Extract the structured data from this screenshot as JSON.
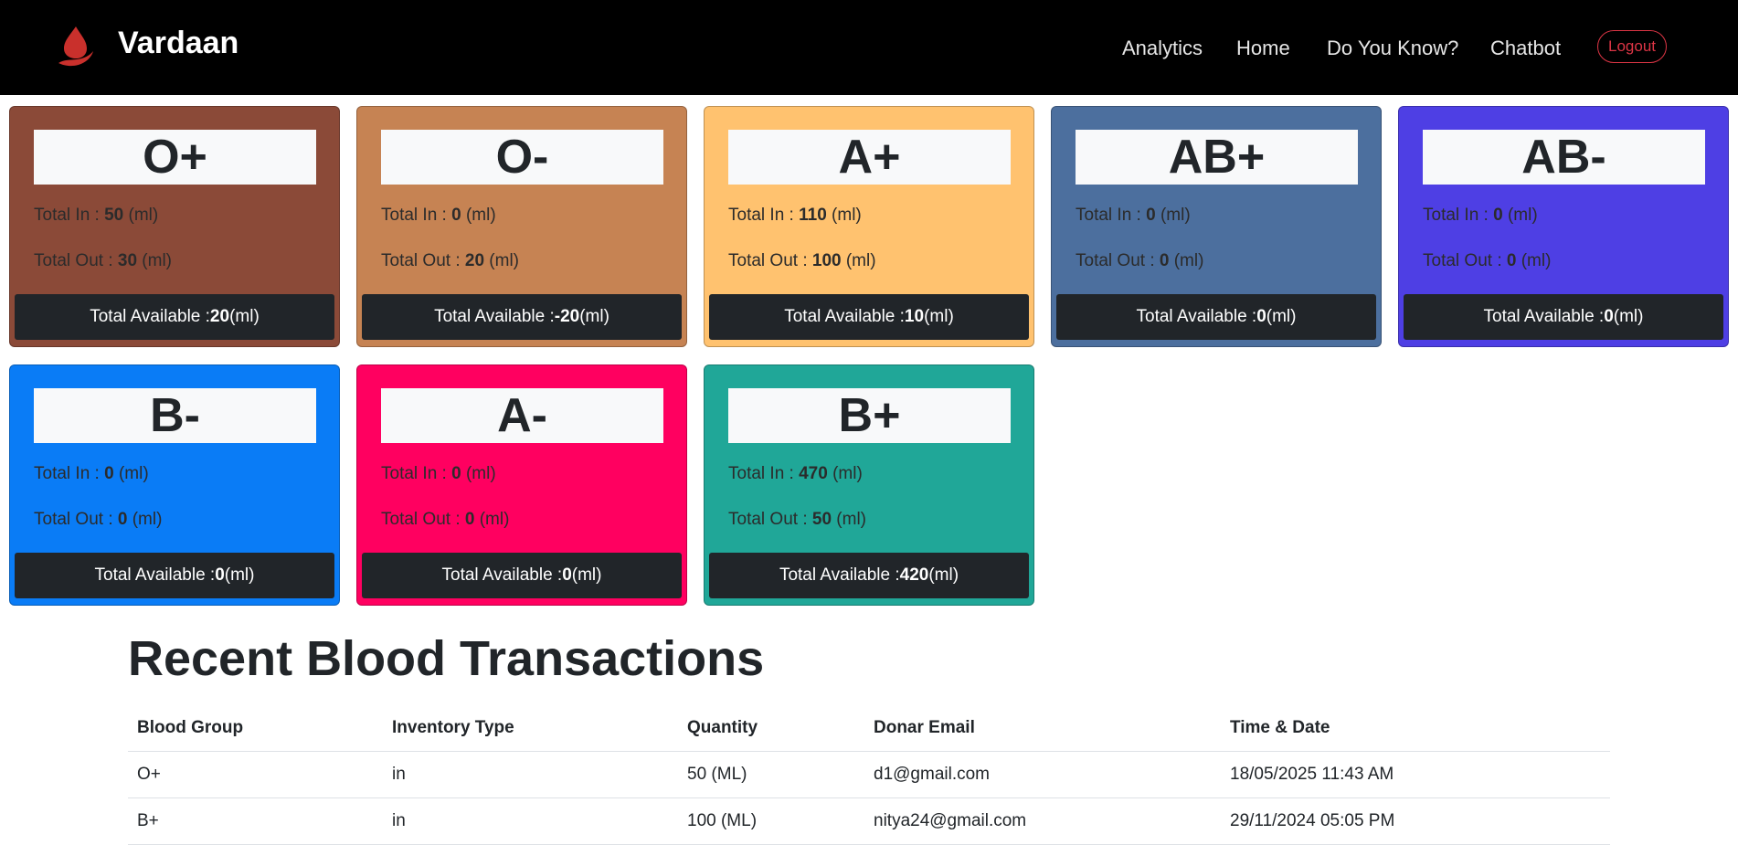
{
  "nav": {
    "brand": "Vardaan",
    "links": [
      "Analytics",
      "Home",
      "Do You Know?",
      "Chatbot"
    ],
    "logout": "Logout"
  },
  "labels": {
    "total_in": "Total In : ",
    "total_out": "Total Out : ",
    "total_available": "Total Available : ",
    "unit": " (ml)"
  },
  "cards": [
    {
      "group": "O+",
      "in": "50",
      "out": "30",
      "available": "20",
      "color": "#8b4a38"
    },
    {
      "group": "O-",
      "in": "0",
      "out": "20",
      "available": "-20",
      "color": "#c68353"
    },
    {
      "group": "A+",
      "in": "110",
      "out": "100",
      "available": "10",
      "color": "#ffc26f"
    },
    {
      "group": "AB+",
      "in": "0",
      "out": "0",
      "available": "0",
      "color": "#4c6f9e"
    },
    {
      "group": "AB-",
      "in": "0",
      "out": "0",
      "available": "0",
      "color": "#4e3fe4"
    },
    {
      "group": "B-",
      "in": "0",
      "out": "0",
      "available": "0",
      "color": "#0a7cf6"
    },
    {
      "group": "A-",
      "in": "0",
      "out": "0",
      "available": "0",
      "color": "#ff0060"
    },
    {
      "group": "B+",
      "in": "470",
      "out": "50",
      "available": "420",
      "color": "#20a798"
    }
  ],
  "transactions": {
    "title": "Recent Blood Transactions",
    "headers": [
      "Blood Group",
      "Inventory Type",
      "Quantity",
      "Donar Email",
      "Time & Date"
    ],
    "rows": [
      [
        "O+",
        "in",
        "50 (ML)",
        "d1@gmail.com",
        "18/05/2025 11:43 AM"
      ],
      [
        "B+",
        "in",
        "100 (ML)",
        "nitya24@gmail.com",
        "29/11/2024 05:05 PM"
      ]
    ]
  }
}
